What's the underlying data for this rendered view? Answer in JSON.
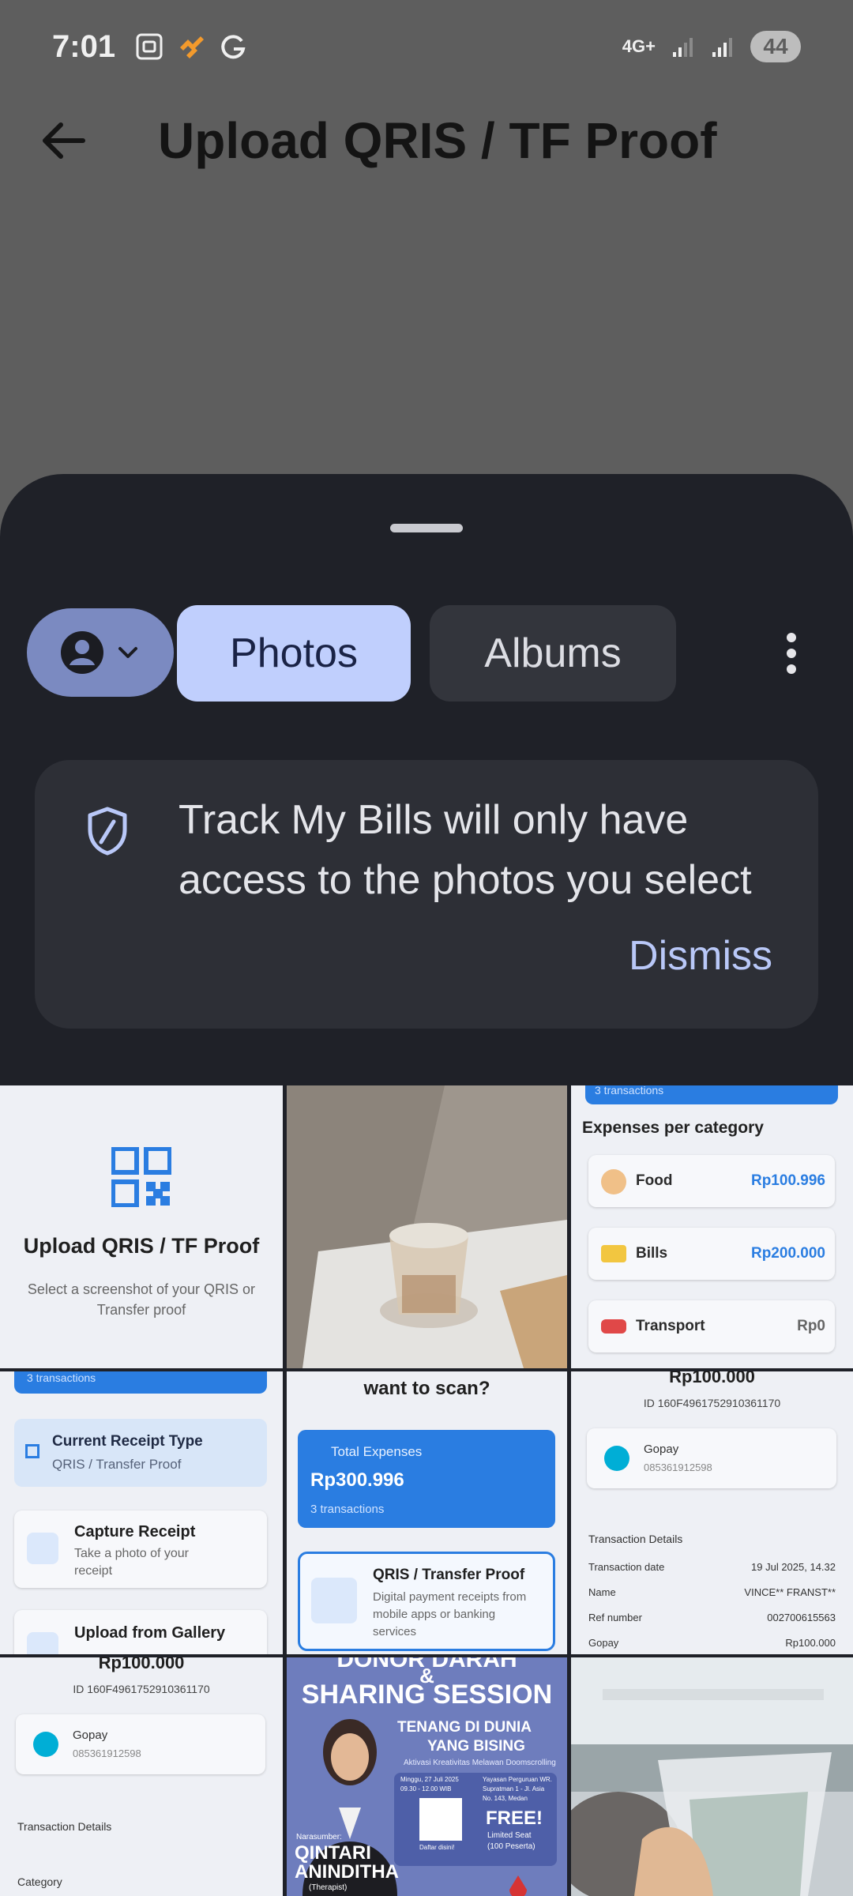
{
  "status_bar": {
    "time": "7:01",
    "network": "4G+",
    "battery": "44"
  },
  "app_bar": {
    "title": "Upload QRIS / TF Proof"
  },
  "picker": {
    "tabs": {
      "photos": "Photos",
      "albums": "Albums"
    },
    "notice": {
      "text": "Track My Bills will only have access to the photos you select",
      "dismiss": "Dismiss"
    }
  },
  "thumbs": {
    "upload_screen": {
      "title": "Upload QRIS / TF Proof",
      "subtitle_line1": "Select a screenshot of your QRIS or",
      "subtitle_line2": "Transfer proof"
    },
    "expenses_category": {
      "top_text": "3 transactions",
      "heading": "Expenses per category",
      "rows": [
        {
          "name": "Food",
          "amount": "Rp100.996"
        },
        {
          "name": "Bills",
          "amount": "Rp200.000"
        },
        {
          "name": "Transport",
          "amount": "Rp0"
        }
      ]
    },
    "receipt_options": {
      "top_text": "3 transactions",
      "current_type_label": "Current Receipt Type",
      "current_type_value": "QRIS / Transfer Proof",
      "capture_title": "Capture Receipt",
      "capture_sub_line1": "Take a photo of your",
      "capture_sub_line2": "receipt",
      "gallery_title": "Upload from Gallery"
    },
    "scan_type": {
      "heading": "want to scan?",
      "total_label": "Total Expenses",
      "total_value": "Rp300.996",
      "total_count": "3 transactions",
      "option_title": "QRIS / Transfer Proof",
      "option_line1": "Digital payment receipts from",
      "option_line2": "mobile apps or banking",
      "option_line3": "services"
    },
    "transaction_open": {
      "amount": "Rp100.000",
      "id": "ID 160F4961752910361170",
      "wallet_name": "Gopay",
      "wallet_number": "085361912598",
      "section": "Transaction Details",
      "rows": [
        {
          "label": "Transaction date",
          "value": "19 Jul 2025, 14.32"
        },
        {
          "label": "Name",
          "value": "VINCE** FRANST**"
        },
        {
          "label": "Ref number",
          "value": "002700615563"
        },
        {
          "label": "Gopay",
          "value": "Rp100.000"
        }
      ]
    },
    "transaction_closed": {
      "amount": "Rp100.000",
      "id": "ID 160F4961752910361170",
      "wallet_name": "Gopay",
      "wallet_number": "085361912598",
      "section": "Transaction Details",
      "category_label": "Category"
    },
    "poster": {
      "line1": "DONOR DARAH",
      "amp": "&",
      "line2": "SHARING SESSION",
      "tag1": "TENANG DI DUNIA",
      "tag2": "YANG BISING",
      "tagline": "Aktivasi Kreativitas Melawan Doomscrolling",
      "date": "Minggu, 27 Juli 2025",
      "time": "09.30 - 12.00 WIB",
      "venue1": "Yayasan Perguruan WR.",
      "venue2": "Supratman 1 - Jl. Asia",
      "venue3": "No. 143, Medan",
      "daftar": "Daftar disini!",
      "free": "FREE!",
      "limited": "Limited Seat",
      "peserta": "(100 Peserta)",
      "narsum": "Narasumber:",
      "name1": "QINTARI",
      "name2": "ANINDITHA",
      "role": "(Therapist)"
    }
  },
  "colors": {
    "accent": "#c0cffd",
    "sheet": "#1f2128",
    "app_blue": "#2a7de1"
  }
}
